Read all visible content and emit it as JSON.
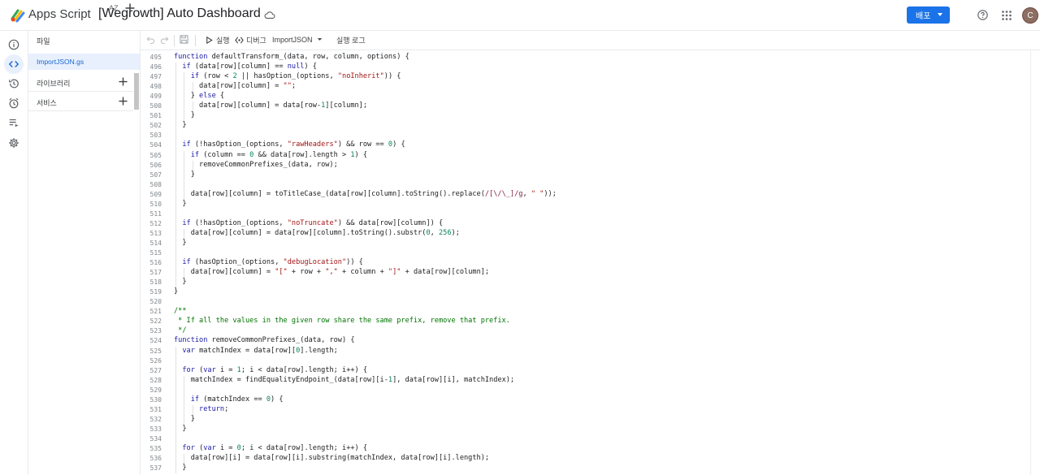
{
  "app": {
    "name": "Apps Script",
    "project_title": "[Wegrowth] Auto Dashboard",
    "deploy_label": "배포",
    "avatar_letter": "C",
    "accent_color": "#1a73e8"
  },
  "rail": {
    "icons": [
      "info-icon",
      "code-icon",
      "history-icon",
      "alarm-icon",
      "executions-icon",
      "settings-icon"
    ],
    "active": "code-icon"
  },
  "files_panel": {
    "header": "파일",
    "sort_label": "AZ",
    "active_file": "ImportJSON.gs",
    "libraries_label": "라이브러리",
    "services_label": "서비스"
  },
  "toolbar": {
    "run_label": "실행",
    "debug_label": "디버그",
    "function_select": "ImportJSON",
    "exec_log_label": "실행 로그"
  },
  "editor": {
    "lines": [
      {
        "n": "495",
        "t": "function defaultTransform_(data, row, column, options) {"
      },
      {
        "n": "496",
        "t": "  if (data[row][column] == null) {"
      },
      {
        "n": "497",
        "t": "    if (row < 2 || hasOption_(options, \"noInherit\")) {"
      },
      {
        "n": "498",
        "t": "      data[row][column] = \"\";"
      },
      {
        "n": "499",
        "t": "    } else {"
      },
      {
        "n": "500",
        "t": "      data[row][column] = data[row-1][column];"
      },
      {
        "n": "501",
        "t": "    }"
      },
      {
        "n": "502",
        "t": "  }"
      },
      {
        "n": "503",
        "t": ""
      },
      {
        "n": "504",
        "t": "  if (!hasOption_(options, \"rawHeaders\") && row == 0) {"
      },
      {
        "n": "505",
        "t": "    if (column == 0 && data[row].length > 1) {"
      },
      {
        "n": "506",
        "t": "      removeCommonPrefixes_(data, row);"
      },
      {
        "n": "507",
        "t": "    }"
      },
      {
        "n": "508",
        "t": ""
      },
      {
        "n": "509",
        "t": "    data[row][column] = toTitleCase_(data[row][column].toString().replace(/[\\/\\_]/g, \" \"));"
      },
      {
        "n": "510",
        "t": "  }"
      },
      {
        "n": "511",
        "t": ""
      },
      {
        "n": "512",
        "t": "  if (!hasOption_(options, \"noTruncate\") && data[row][column]) {"
      },
      {
        "n": "513",
        "t": "    data[row][column] = data[row][column].toString().substr(0, 256);"
      },
      {
        "n": "514",
        "t": "  }"
      },
      {
        "n": "515",
        "t": ""
      },
      {
        "n": "516",
        "t": "  if (hasOption_(options, \"debugLocation\")) {"
      },
      {
        "n": "517",
        "t": "    data[row][column] = \"[\" + row + \",\" + column + \"]\" + data[row][column];"
      },
      {
        "n": "518",
        "t": "  }"
      },
      {
        "n": "519",
        "t": "}"
      },
      {
        "n": "520",
        "t": ""
      },
      {
        "n": "521",
        "t": "/**"
      },
      {
        "n": "522",
        "t": " * If all the values in the given row share the same prefix, remove that prefix."
      },
      {
        "n": "523",
        "t": " */"
      },
      {
        "n": "524",
        "t": "function removeCommonPrefixes_(data, row) {"
      },
      {
        "n": "525",
        "t": "  var matchIndex = data[row][0].length;"
      },
      {
        "n": "526",
        "t": ""
      },
      {
        "n": "527",
        "t": "  for (var i = 1; i < data[row].length; i++) {"
      },
      {
        "n": "528",
        "t": "    matchIndex = findEqualityEndpoint_(data[row][i-1], data[row][i], matchIndex);"
      },
      {
        "n": "529",
        "t": ""
      },
      {
        "n": "530",
        "t": "    if (matchIndex == 0) {"
      },
      {
        "n": "531",
        "t": "      return;"
      },
      {
        "n": "532",
        "t": "    }"
      },
      {
        "n": "533",
        "t": "  }"
      },
      {
        "n": "534",
        "t": ""
      },
      {
        "n": "535",
        "t": "  for (var i = 0; i < data[row].length; i++) {"
      },
      {
        "n": "536",
        "t": "    data[row][i] = data[row][i].substring(matchIndex, data[row][i].length);"
      },
      {
        "n": "537",
        "t": "  }"
      }
    ]
  }
}
